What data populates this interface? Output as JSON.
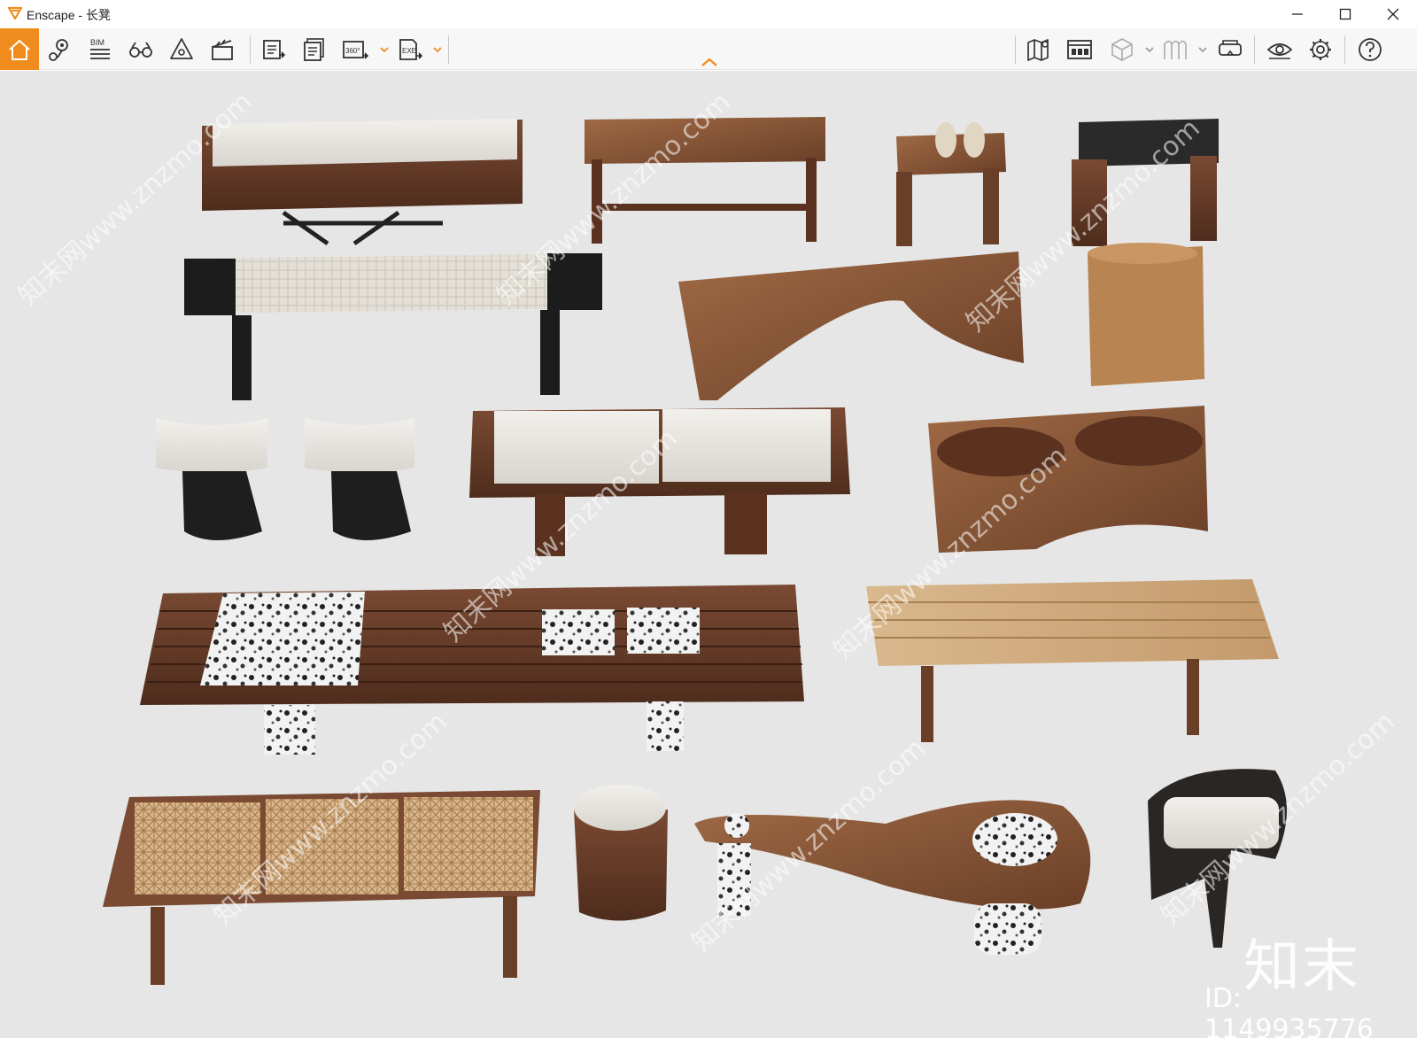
{
  "window": {
    "title": "Enscape - 长凳",
    "controls": [
      "minimize",
      "maximize",
      "close"
    ]
  },
  "toolbar": {
    "left_items": [
      {
        "name": "home-icon",
        "active": true
      },
      {
        "name": "location-pin-icon"
      },
      {
        "name": "bim-icon",
        "label": "BIM"
      },
      {
        "name": "binoculars-icon"
      },
      {
        "name": "visual-settings-icon"
      },
      {
        "name": "clapperboard-icon"
      },
      {
        "name": "render-image-icon"
      },
      {
        "name": "batch-render-icon"
      },
      {
        "name": "panorama-360-icon",
        "label": "360°"
      },
      {
        "name": "export-exe-icon",
        "label": "EXE"
      }
    ],
    "right_items": [
      {
        "name": "map-icon"
      },
      {
        "name": "asset-library-icon"
      },
      {
        "name": "cube-view-icon"
      },
      {
        "name": "collaboration-icon"
      },
      {
        "name": "vr-headset-icon"
      },
      {
        "name": "eye-icon"
      },
      {
        "name": "settings-gear-icon"
      },
      {
        "name": "help-icon"
      }
    ],
    "accent_color": "#f08c1e"
  },
  "viewport": {
    "background": "#e6e6e6",
    "watermark": {
      "brand": "知末",
      "id_text": "ID: 1149935776",
      "site_text": "知末网www.znzmo.com"
    }
  }
}
